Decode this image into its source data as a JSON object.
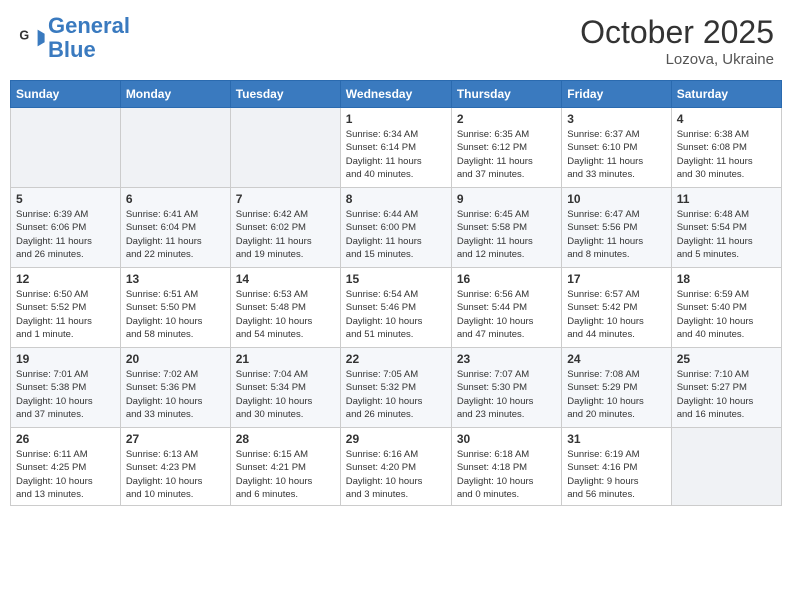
{
  "header": {
    "logo_line1": "General",
    "logo_line2": "Blue",
    "month": "October 2025",
    "location": "Lozova, Ukraine"
  },
  "weekdays": [
    "Sunday",
    "Monday",
    "Tuesday",
    "Wednesday",
    "Thursday",
    "Friday",
    "Saturday"
  ],
  "weeks": [
    [
      {
        "day": "",
        "info": ""
      },
      {
        "day": "",
        "info": ""
      },
      {
        "day": "",
        "info": ""
      },
      {
        "day": "1",
        "info": "Sunrise: 6:34 AM\nSunset: 6:14 PM\nDaylight: 11 hours\nand 40 minutes."
      },
      {
        "day": "2",
        "info": "Sunrise: 6:35 AM\nSunset: 6:12 PM\nDaylight: 11 hours\nand 37 minutes."
      },
      {
        "day": "3",
        "info": "Sunrise: 6:37 AM\nSunset: 6:10 PM\nDaylight: 11 hours\nand 33 minutes."
      },
      {
        "day": "4",
        "info": "Sunrise: 6:38 AM\nSunset: 6:08 PM\nDaylight: 11 hours\nand 30 minutes."
      }
    ],
    [
      {
        "day": "5",
        "info": "Sunrise: 6:39 AM\nSunset: 6:06 PM\nDaylight: 11 hours\nand 26 minutes."
      },
      {
        "day": "6",
        "info": "Sunrise: 6:41 AM\nSunset: 6:04 PM\nDaylight: 11 hours\nand 22 minutes."
      },
      {
        "day": "7",
        "info": "Sunrise: 6:42 AM\nSunset: 6:02 PM\nDaylight: 11 hours\nand 19 minutes."
      },
      {
        "day": "8",
        "info": "Sunrise: 6:44 AM\nSunset: 6:00 PM\nDaylight: 11 hours\nand 15 minutes."
      },
      {
        "day": "9",
        "info": "Sunrise: 6:45 AM\nSunset: 5:58 PM\nDaylight: 11 hours\nand 12 minutes."
      },
      {
        "day": "10",
        "info": "Sunrise: 6:47 AM\nSunset: 5:56 PM\nDaylight: 11 hours\nand 8 minutes."
      },
      {
        "day": "11",
        "info": "Sunrise: 6:48 AM\nSunset: 5:54 PM\nDaylight: 11 hours\nand 5 minutes."
      }
    ],
    [
      {
        "day": "12",
        "info": "Sunrise: 6:50 AM\nSunset: 5:52 PM\nDaylight: 11 hours\nand 1 minute."
      },
      {
        "day": "13",
        "info": "Sunrise: 6:51 AM\nSunset: 5:50 PM\nDaylight: 10 hours\nand 58 minutes."
      },
      {
        "day": "14",
        "info": "Sunrise: 6:53 AM\nSunset: 5:48 PM\nDaylight: 10 hours\nand 54 minutes."
      },
      {
        "day": "15",
        "info": "Sunrise: 6:54 AM\nSunset: 5:46 PM\nDaylight: 10 hours\nand 51 minutes."
      },
      {
        "day": "16",
        "info": "Sunrise: 6:56 AM\nSunset: 5:44 PM\nDaylight: 10 hours\nand 47 minutes."
      },
      {
        "day": "17",
        "info": "Sunrise: 6:57 AM\nSunset: 5:42 PM\nDaylight: 10 hours\nand 44 minutes."
      },
      {
        "day": "18",
        "info": "Sunrise: 6:59 AM\nSunset: 5:40 PM\nDaylight: 10 hours\nand 40 minutes."
      }
    ],
    [
      {
        "day": "19",
        "info": "Sunrise: 7:01 AM\nSunset: 5:38 PM\nDaylight: 10 hours\nand 37 minutes."
      },
      {
        "day": "20",
        "info": "Sunrise: 7:02 AM\nSunset: 5:36 PM\nDaylight: 10 hours\nand 33 minutes."
      },
      {
        "day": "21",
        "info": "Sunrise: 7:04 AM\nSunset: 5:34 PM\nDaylight: 10 hours\nand 30 minutes."
      },
      {
        "day": "22",
        "info": "Sunrise: 7:05 AM\nSunset: 5:32 PM\nDaylight: 10 hours\nand 26 minutes."
      },
      {
        "day": "23",
        "info": "Sunrise: 7:07 AM\nSunset: 5:30 PM\nDaylight: 10 hours\nand 23 minutes."
      },
      {
        "day": "24",
        "info": "Sunrise: 7:08 AM\nSunset: 5:29 PM\nDaylight: 10 hours\nand 20 minutes."
      },
      {
        "day": "25",
        "info": "Sunrise: 7:10 AM\nSunset: 5:27 PM\nDaylight: 10 hours\nand 16 minutes."
      }
    ],
    [
      {
        "day": "26",
        "info": "Sunrise: 6:11 AM\nSunset: 4:25 PM\nDaylight: 10 hours\nand 13 minutes."
      },
      {
        "day": "27",
        "info": "Sunrise: 6:13 AM\nSunset: 4:23 PM\nDaylight: 10 hours\nand 10 minutes."
      },
      {
        "day": "28",
        "info": "Sunrise: 6:15 AM\nSunset: 4:21 PM\nDaylight: 10 hours\nand 6 minutes."
      },
      {
        "day": "29",
        "info": "Sunrise: 6:16 AM\nSunset: 4:20 PM\nDaylight: 10 hours\nand 3 minutes."
      },
      {
        "day": "30",
        "info": "Sunrise: 6:18 AM\nSunset: 4:18 PM\nDaylight: 10 hours\nand 0 minutes."
      },
      {
        "day": "31",
        "info": "Sunrise: 6:19 AM\nSunset: 4:16 PM\nDaylight: 9 hours\nand 56 minutes."
      },
      {
        "day": "",
        "info": ""
      }
    ]
  ]
}
